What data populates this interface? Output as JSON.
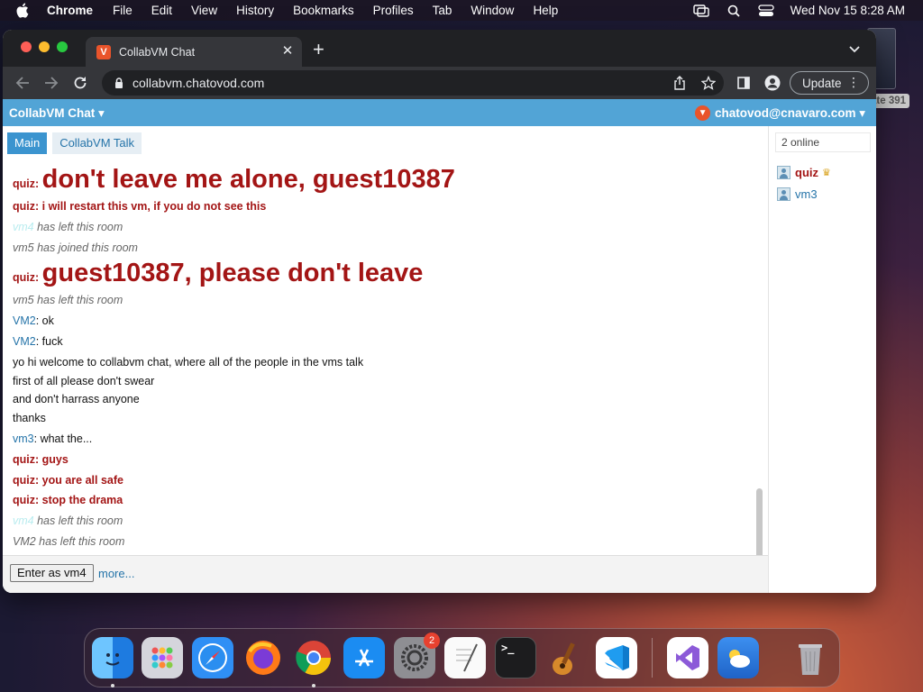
{
  "menubar": {
    "app_name": "Chrome",
    "items": [
      "File",
      "Edit",
      "View",
      "History",
      "Bookmarks",
      "Profiles",
      "Tab",
      "Window",
      "Help"
    ],
    "clock": "Wed Nov 15  8:28 AM"
  },
  "desktop": {
    "badge_text": "ate 391"
  },
  "browser": {
    "tab_title": "CollabVM Chat",
    "favicon_letter": "V",
    "url": "collabvm.chatovod.com",
    "update_label": "Update"
  },
  "app": {
    "brand": "CollabVM Chat ▾",
    "account": "chatovod@cnavaro.com ▾",
    "tabs": [
      "Main",
      "CollabVM Talk"
    ]
  },
  "chat": {
    "messages": [
      {
        "nick": "quiz",
        "sep": ": ",
        "text": "don't leave me alone, guest10387"
      },
      {
        "nick": "quiz",
        "sep": ": ",
        "text": "i will restart this vm, if you do not see this"
      },
      {
        "nick": "vm4",
        "text": " has left this room"
      },
      {
        "text": "vm5 has joined this room"
      },
      {
        "nick": "quiz",
        "sep": ": ",
        "text": "guest10387, please don't leave"
      },
      {
        "text": "vm5 has left this room"
      },
      {
        "nick": "VM2",
        "sep": ": ",
        "text": "ok"
      },
      {
        "nick": "VM2",
        "sep": ": ",
        "text": "fuck"
      },
      {
        "text": "yo hi welcome to collabvm chat, where all of the people in the vms talk"
      },
      {
        "text": "first of all please don't swear"
      },
      {
        "text": "and don't harrass anyone"
      },
      {
        "text": "thanks"
      },
      {
        "nick": "vm3",
        "sep": ": ",
        "text": "what the..."
      },
      {
        "nick": "quiz",
        "sep": ": ",
        "text": "guys"
      },
      {
        "nick": "quiz",
        "sep": ": ",
        "text": "you are all safe"
      },
      {
        "nick": "quiz",
        "sep": ": ",
        "text": "stop the drama"
      },
      {
        "nick": "vm4",
        "text": " has left this room"
      },
      {
        "text": "VM2 has left this room"
      }
    ]
  },
  "sidebar": {
    "online": "2 online",
    "users": [
      {
        "name": "quiz",
        "crown": "♛"
      },
      {
        "name": "vm3"
      }
    ]
  },
  "bottom": {
    "enter_button": "Enter as vm4",
    "more": "more..."
  },
  "dock": {
    "apps": [
      "Finder",
      "Launchpad",
      "Safari",
      "Firefox",
      "Chrome",
      "App Store",
      "System Settings",
      "TextEdit",
      "Terminal",
      "GarageBand",
      "Visual Studio Code",
      "Visual Studio",
      "Weather",
      "Trash"
    ],
    "settings_badge": "2"
  }
}
